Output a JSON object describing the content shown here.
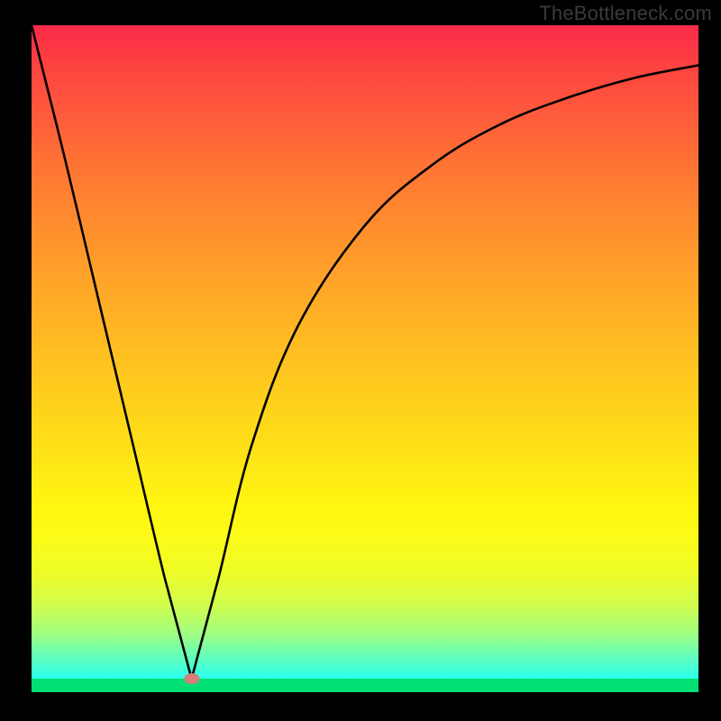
{
  "attribution": "TheBottleneck.com",
  "chart_data": {
    "type": "line",
    "title": "",
    "xlabel": "",
    "ylabel": "",
    "xlim": [
      0,
      100
    ],
    "ylim": [
      0,
      100
    ],
    "grid": false,
    "legend": false,
    "note": "Vertical gradient background from red (top) through yellow to cyan/green (bottom). Single black V-shaped curve with a sharp minimum near x≈24, y≈2; left branch steep and nearly linear, right branch rises with decreasing slope toward the top-right. Small salmon-colored elliptical marker at the curve minimum. Thin green strip at the very bottom.",
    "series": [
      {
        "name": "curve",
        "x": [
          0,
          5,
          10,
          15,
          20,
          24,
          28,
          33,
          40,
          50,
          60,
          70,
          80,
          90,
          100
        ],
        "y": [
          100,
          80,
          59,
          38,
          17,
          2,
          17,
          37,
          55,
          70,
          79,
          85,
          89,
          92,
          94
        ]
      }
    ],
    "marker": {
      "x": 24,
      "y": 2,
      "color": "#d77d75"
    },
    "gradient_stops": [
      {
        "pos": 0,
        "color": "#fb2a4a"
      },
      {
        "pos": 0.06,
        "color": "#fd4240"
      },
      {
        "pos": 0.14,
        "color": "#fe5d3b"
      },
      {
        "pos": 0.22,
        "color": "#ff7733"
      },
      {
        "pos": 0.38,
        "color": "#ffa329"
      },
      {
        "pos": 0.52,
        "color": "#ffc61f"
      },
      {
        "pos": 0.64,
        "color": "#fee217"
      },
      {
        "pos": 0.72,
        "color": "#fff611"
      },
      {
        "pos": 0.77,
        "color": "#fbfb17"
      },
      {
        "pos": 0.82,
        "color": "#eefc28"
      },
      {
        "pos": 0.87,
        "color": "#d0fd4e"
      },
      {
        "pos": 0.91,
        "color": "#a3fe7d"
      },
      {
        "pos": 0.94,
        "color": "#6efeb1"
      },
      {
        "pos": 0.965,
        "color": "#44ffd6"
      },
      {
        "pos": 0.985,
        "color": "#1ffff3"
      },
      {
        "pos": 1.0,
        "color": "#09fcff"
      }
    ],
    "ground_color": "#00df74"
  }
}
